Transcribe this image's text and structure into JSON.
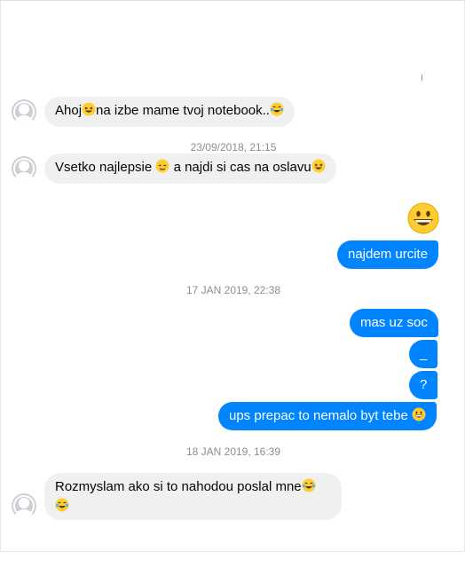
{
  "conversation": {
    "messages": [
      {
        "id": "m1",
        "side": "in",
        "parts": [
          "Ahoj",
          "grin-squint",
          "na izbe mame tvoj notebook..",
          "tears-of-joy"
        ]
      },
      {
        "id": "m2",
        "side": "in",
        "parts": [
          "Vsetko najlepsie ",
          "relieved",
          " a najdi si cas na oslavu",
          "grin-squint"
        ]
      },
      {
        "id": "m3",
        "side": "out",
        "emoji": "grinning-big"
      },
      {
        "id": "m4",
        "side": "out",
        "text": "najdem urcite"
      },
      {
        "id": "m5",
        "side": "out",
        "text": "mas uz soc"
      },
      {
        "id": "m6",
        "side": "out",
        "text": "_"
      },
      {
        "id": "m7",
        "side": "out",
        "text": "?"
      },
      {
        "id": "m8",
        "side": "out",
        "parts": [
          "ups prepac to nemalo byt tebe ",
          "grinning"
        ]
      },
      {
        "id": "m9",
        "side": "in",
        "parts": [
          "Rozmyslam ako si to nahodou poslal mne",
          "tears-of-joy",
          "tears-of-joy"
        ]
      }
    ],
    "timestamps": {
      "t1": "23/09/2018, 21:15",
      "t2": "17 JAN 2019, 22:38",
      "t3": "18 JAN 2019, 16:39"
    }
  },
  "colors": {
    "outgoing_bubble": "#0084ff",
    "incoming_bubble": "#f0f0f0",
    "timestamp_text": "#8a8d91",
    "emoji_yellow": "#ffcc33"
  },
  "text": {
    "m1_a": "Ahoj",
    "m1_b": "na izbe mame tvoj notebook..",
    "m2_a": "Vsetko najlepsie ",
    "m2_b": " a najdi si cas na oslavu",
    "m4": "najdem urcite",
    "m5": "mas uz soc",
    "m6": "_",
    "m7": "?",
    "m8": "ups prepac to nemalo byt tebe ",
    "m9_a": "Rozmyslam ako si to nahodou poslal mne"
  }
}
